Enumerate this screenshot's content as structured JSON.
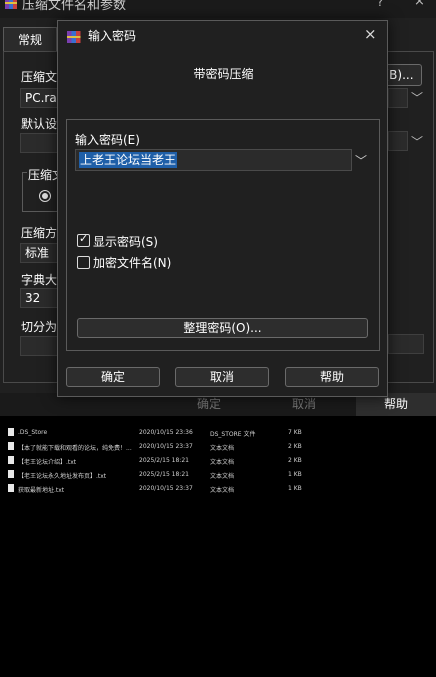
{
  "background_dialog": {
    "title": "压缩文件名和参数",
    "help_glyph": "?",
    "close_glyph": "×",
    "tab_general": "常规",
    "archive_name_label": "压缩文",
    "archive_name_value": "PC.rar",
    "browse_label": "(B)...",
    "default_settings_label": "默认设",
    "archive_format_label": "压缩文",
    "compression_method_label": "压缩方",
    "compression_method_value": "标准",
    "dictionary_label": "字典大",
    "dictionary_value": "32",
    "split_label": "切分为",
    "footer_ok": "确定",
    "footer_cancel": "取消",
    "footer_help": "帮助"
  },
  "password_dialog": {
    "title": "输入密码",
    "close_glyph": "×",
    "subtitle": "带密码压缩",
    "password_label": "输入密码(E)",
    "password_value": "上老王论坛当老王",
    "show_password_label": "显示密码(S)",
    "show_password_checked": true,
    "encrypt_names_label": "加密文件名(N)",
    "encrypt_names_checked": false,
    "organize_button": "整理密码(O)...",
    "ok_button": "确定",
    "cancel_button": "取消",
    "help_button": "帮助"
  },
  "file_list": [
    {
      "name": ".DS_Store",
      "date": "2020/10/15 23:36",
      "type": "DS_STORE 文件",
      "size": "7 KB"
    },
    {
      "name": "【本了就能下载和观看的论坛，纯免费！...",
      "date": "2020/10/15 23:37",
      "type": "文本文档",
      "size": "2 KB"
    },
    {
      "name": "【老王论坛介绍】.txt",
      "date": "2025/2/15 18:21",
      "type": "文本文档",
      "size": "2 KB"
    },
    {
      "name": "【老王论坛永久地址发布页】.txt",
      "date": "2025/2/15 18:21",
      "type": "文本文档",
      "size": "1 KB"
    },
    {
      "name": "获取最新地址.txt",
      "date": "2020/10/15 23:37",
      "type": "文本文档",
      "size": "1 KB"
    }
  ],
  "colors": {
    "dialog_bg": "#202020",
    "selection": "#1f5fa8",
    "border": "#5a5a5a"
  }
}
